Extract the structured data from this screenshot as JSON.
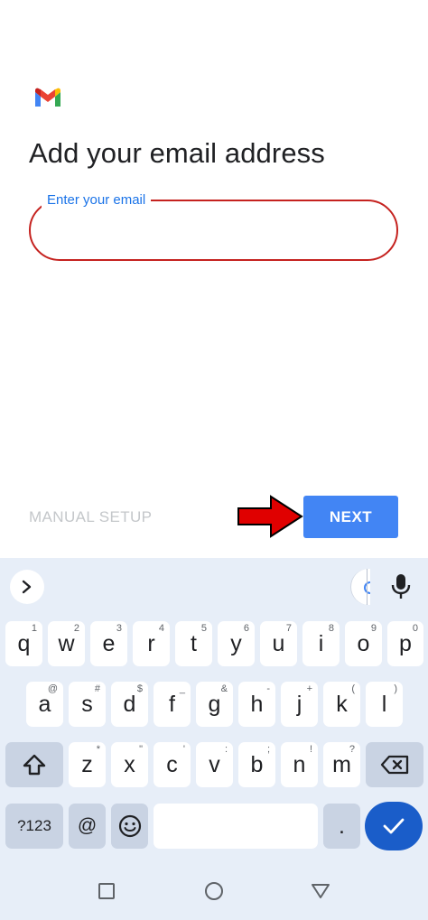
{
  "app": {
    "title": "Add your email address",
    "email_field": {
      "label": "Enter your email",
      "value": ""
    },
    "manual_setup_label": "MANUAL SETUP",
    "next_label": "NEXT",
    "colors": {
      "accent": "#4285f4",
      "error_outline": "#c5221f",
      "label": "#1a73e8",
      "arrow": "#e00000"
    }
  },
  "keyboard": {
    "toolbar": {
      "expand_icon": "chevron-right-icon",
      "mic_icon": "mic-icon"
    },
    "rows": [
      [
        {
          "label": "q",
          "hint": "1"
        },
        {
          "label": "w",
          "hint": "2"
        },
        {
          "label": "e",
          "hint": "3"
        },
        {
          "label": "r",
          "hint": "4"
        },
        {
          "label": "t",
          "hint": "5"
        },
        {
          "label": "y",
          "hint": "6"
        },
        {
          "label": "u",
          "hint": "7"
        },
        {
          "label": "i",
          "hint": "8"
        },
        {
          "label": "o",
          "hint": "9"
        },
        {
          "label": "p",
          "hint": "0"
        }
      ],
      [
        {
          "label": "a",
          "hint": "@"
        },
        {
          "label": "s",
          "hint": "#"
        },
        {
          "label": "d",
          "hint": "$"
        },
        {
          "label": "f",
          "hint": "_"
        },
        {
          "label": "g",
          "hint": "&"
        },
        {
          "label": "h",
          "hint": "-"
        },
        {
          "label": "j",
          "hint": "+"
        },
        {
          "label": "k",
          "hint": "("
        },
        {
          "label": "l",
          "hint": ")"
        }
      ],
      [
        {
          "label": "z",
          "hint": "*"
        },
        {
          "label": "x",
          "hint": "\""
        },
        {
          "label": "c",
          "hint": "'"
        },
        {
          "label": "v",
          "hint": ":"
        },
        {
          "label": "b",
          "hint": ";"
        },
        {
          "label": "n",
          "hint": "!"
        },
        {
          "label": "m",
          "hint": "?"
        }
      ]
    ],
    "bottom": {
      "symbols_label": "?123",
      "at_label": "@",
      "period_label": "."
    }
  },
  "navbar": {
    "recents_icon": "square-icon",
    "home_icon": "circle-icon",
    "back_icon": "triangle-back-icon"
  }
}
